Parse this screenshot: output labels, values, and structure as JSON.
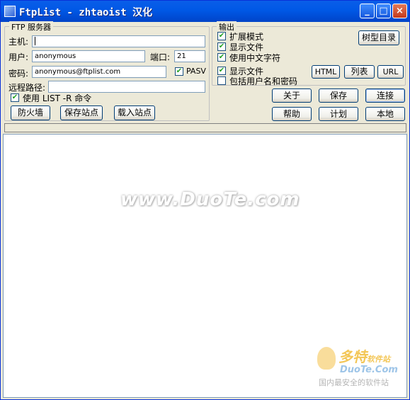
{
  "window": {
    "title": "FtpList - zhtaoist 汉化",
    "min_glyph": "_",
    "max_glyph": "□",
    "close_glyph": "×"
  },
  "ftp_group": {
    "legend": "FTP 服务器",
    "host_label": "主机:",
    "host_value": "",
    "user_label": "用户:",
    "user_value": "anonymous",
    "port_label": "端口:",
    "port_value": "21",
    "password_label": "密码:",
    "password_value": "anonymous@ftplist.com",
    "pasv_label": "PASV",
    "pasv_checked": true,
    "remote_path_label": "远程路径:",
    "remote_path_value": "",
    "list_r_label": "使用 LIST -R 命令",
    "list_r_checked": true,
    "firewall_button": "防火墙",
    "save_site_button": "保存站点",
    "load_site_button": "载入站点"
  },
  "output_group": {
    "legend": "输出",
    "extended_mode_label": "扩展模式",
    "extended_mode_checked": true,
    "show_files_label": "显示文件",
    "show_files_checked": true,
    "chinese_chars_label": "使用中文字符",
    "chinese_chars_checked": true,
    "show_files2_label": "显示文件",
    "show_files2_checked": true,
    "include_credentials_label": "包括用户名和密码",
    "include_credentials_checked": false,
    "tree_dir_button": "树型目录",
    "html_button": "HTML",
    "list_button": "列表",
    "url_button": "URL"
  },
  "actions": {
    "about": "关于",
    "save": "保存",
    "connect": "连接",
    "help": "帮助",
    "schedule": "计划",
    "local": "本地"
  },
  "watermark": {
    "center_text": "www.DuoTe.com",
    "logo_cn_big": "多特",
    "logo_cn_small": "软件站",
    "logo_en": "DuoTe.Com",
    "logo_slogan": "国内最安全的软件站"
  }
}
